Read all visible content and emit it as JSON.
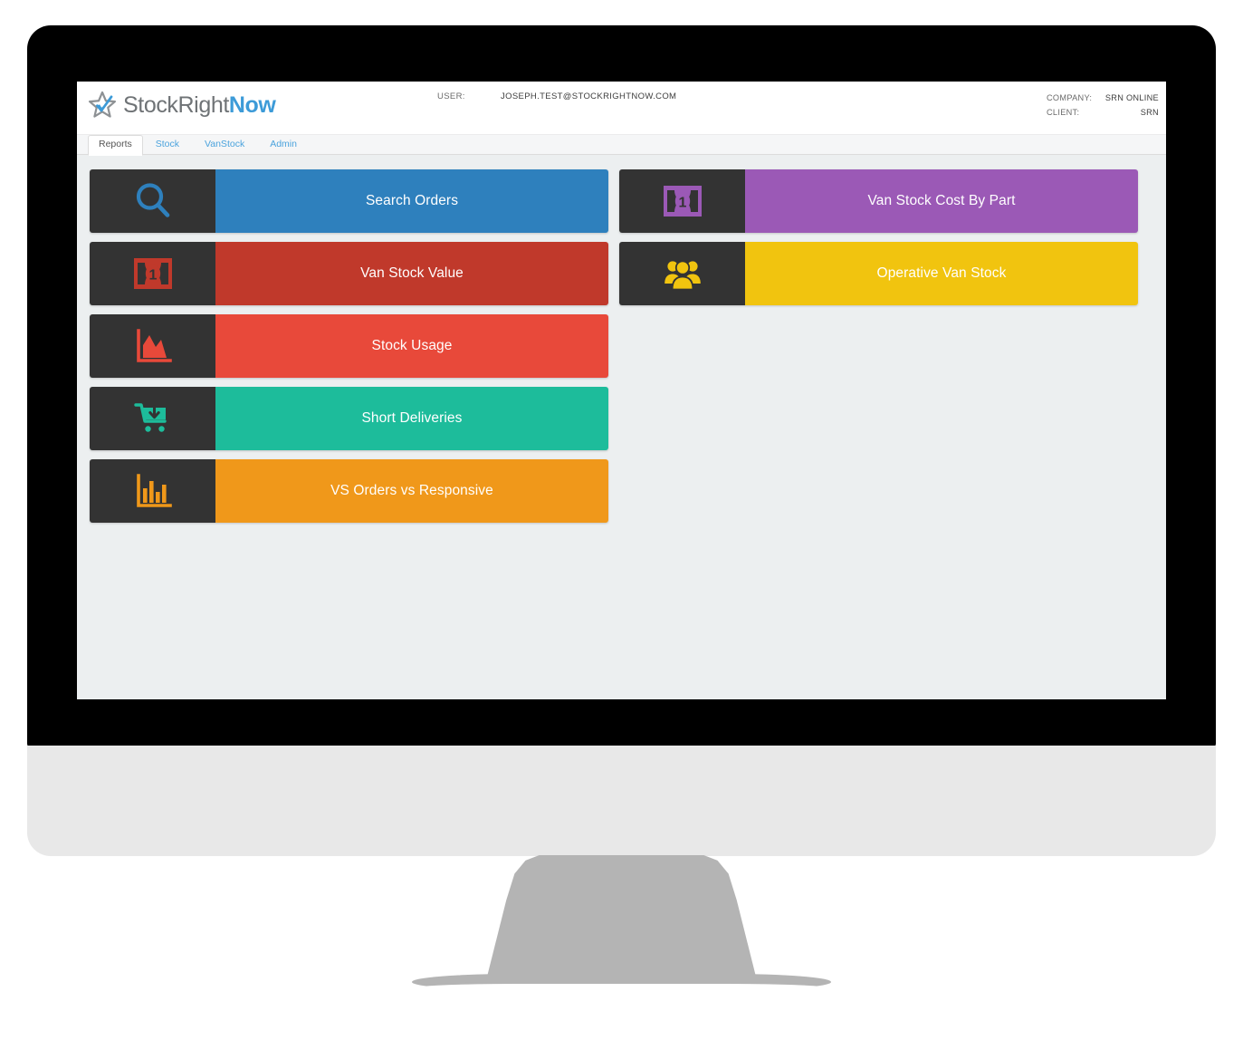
{
  "header": {
    "logo_text_left": "StockRight",
    "logo_text_accent": "Now",
    "logo_icon": "star-check-logo",
    "user_label": "USER:",
    "user_value": "JOSEPH.TEST@STOCKRIGHTNOW.COM",
    "company_label": "COMPANY:",
    "company_value": "SRN ONLINE",
    "client_label": "CLIENT:",
    "client_value": "SRN"
  },
  "nav": {
    "tabs": [
      {
        "label": "Reports",
        "active": true
      },
      {
        "label": "Stock",
        "active": false
      },
      {
        "label": "VanStock",
        "active": false
      },
      {
        "label": "Admin",
        "active": false
      }
    ]
  },
  "main": {
    "left_tiles": [
      {
        "label": "Search Orders",
        "color": "#2e80bd",
        "icon": "magnifier-icon"
      },
      {
        "label": "Van Stock Value",
        "color": "#c0392b",
        "icon": "banknote-icon"
      },
      {
        "label": "Stock Usage",
        "color": "#e8493a",
        "icon": "area-chart-icon"
      },
      {
        "label": "Short Deliveries",
        "color": "#1dbc9b",
        "icon": "cart-download-icon"
      },
      {
        "label": "VS Orders vs Responsive",
        "color": "#f0981a",
        "icon": "bar-chart-icon"
      }
    ],
    "right_tiles": [
      {
        "label": "Van Stock Cost By Part",
        "color": "#9b59b6",
        "icon": "banknote-icon"
      },
      {
        "label": "Operative Van Stock",
        "color": "#f1c40f",
        "icon": "users-group-icon"
      }
    ],
    "icon_panel_color": "#333333"
  },
  "device": {
    "bezel_color": "#000000",
    "chin_color": "#e8e8e8",
    "stand_color": "#b4b4b4"
  }
}
